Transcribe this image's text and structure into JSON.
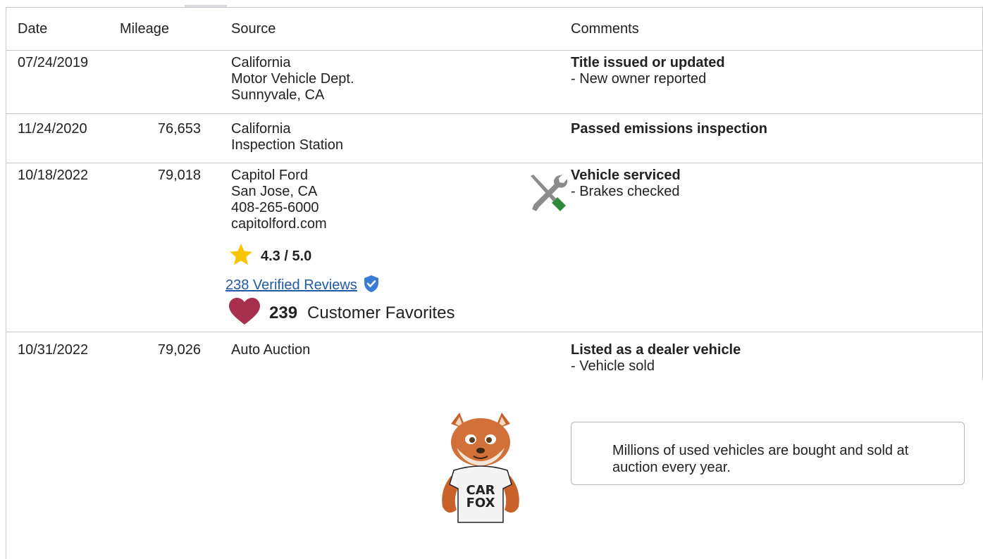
{
  "table": {
    "headers": {
      "date": "Date",
      "mileage": "Mileage",
      "source": "Source",
      "comments": "Comments"
    },
    "rows": [
      {
        "date": "07/24/2019",
        "mileage": "",
        "source": [
          "California",
          "Motor Vehicle Dept.",
          "Sunnyvale, CA"
        ],
        "comment_title": "Title issued or updated",
        "comment_detail": "- New owner reported"
      },
      {
        "date": "11/24/2020",
        "mileage": "76,653",
        "source": [
          "California",
          "Inspection Station"
        ],
        "comment_title": "Passed emissions inspection",
        "comment_detail": ""
      },
      {
        "date": "10/18/2022",
        "mileage": "79,018",
        "source": [
          "Capitol Ford",
          "San Jose, CA",
          "408-265-6000",
          "capitolford.com"
        ],
        "rating": "4.3 / 5.0",
        "reviews_link": "238 Verified Reviews",
        "favorites_count": "239",
        "favorites_label": "Customer Favorites",
        "service_icon": "wrench-screwdriver-icon",
        "comment_title": "Vehicle serviced",
        "comment_detail": "- Brakes checked"
      },
      {
        "date": "10/31/2022",
        "mileage": "79,026",
        "source": [
          "Auto Auction"
        ],
        "comment_title": "Listed as a dealer vehicle",
        "comment_detail": "- Vehicle sold"
      }
    ]
  },
  "mascot": {
    "shirt_line1": "CAR",
    "shirt_line2": "FOX"
  },
  "callout": {
    "text": "Millions of used vehicles are bought and sold at auction every year."
  },
  "colors": {
    "star": "#f7c600",
    "heart": "#a8304f",
    "link": "#1f5aa6",
    "shield": "#3a7bd5",
    "tool_green": "#2e8b3a",
    "tool_gray": "#8c8c8c"
  }
}
